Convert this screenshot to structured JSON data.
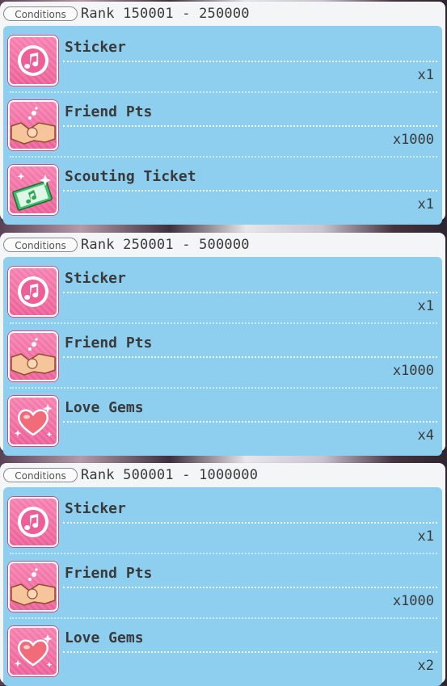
{
  "condition_badge": "Conditions",
  "tiers": [
    {
      "rank": "Rank 150001 - 250000",
      "rewards": [
        {
          "name": "Sticker",
          "qty": "x1",
          "icon": "music-note-icon"
        },
        {
          "name": "Friend Pts",
          "qty": "x1000",
          "icon": "handshake-icon"
        },
        {
          "name": "Scouting Ticket",
          "qty": "x1",
          "icon": "scouting-ticket-icon"
        }
      ]
    },
    {
      "rank": "Rank 250001 - 500000",
      "rewards": [
        {
          "name": "Sticker",
          "qty": "x1",
          "icon": "music-note-icon"
        },
        {
          "name": "Friend Pts",
          "qty": "x1000",
          "icon": "handshake-icon"
        },
        {
          "name": "Love Gems",
          "qty": "x4",
          "icon": "heart-gem-icon"
        }
      ]
    },
    {
      "rank": "Rank 500001 - 1000000",
      "rewards": [
        {
          "name": "Sticker",
          "qty": "x1",
          "icon": "music-note-icon"
        },
        {
          "name": "Friend Pts",
          "qty": "x1000",
          "icon": "handshake-icon"
        },
        {
          "name": "Love Gems",
          "qty": "x2",
          "icon": "heart-gem-icon"
        }
      ]
    }
  ],
  "colors": {
    "panel_bg": "#f4f5f7",
    "rewards_bg": "#8ecff0",
    "icon_bg": "#ec5f97"
  }
}
